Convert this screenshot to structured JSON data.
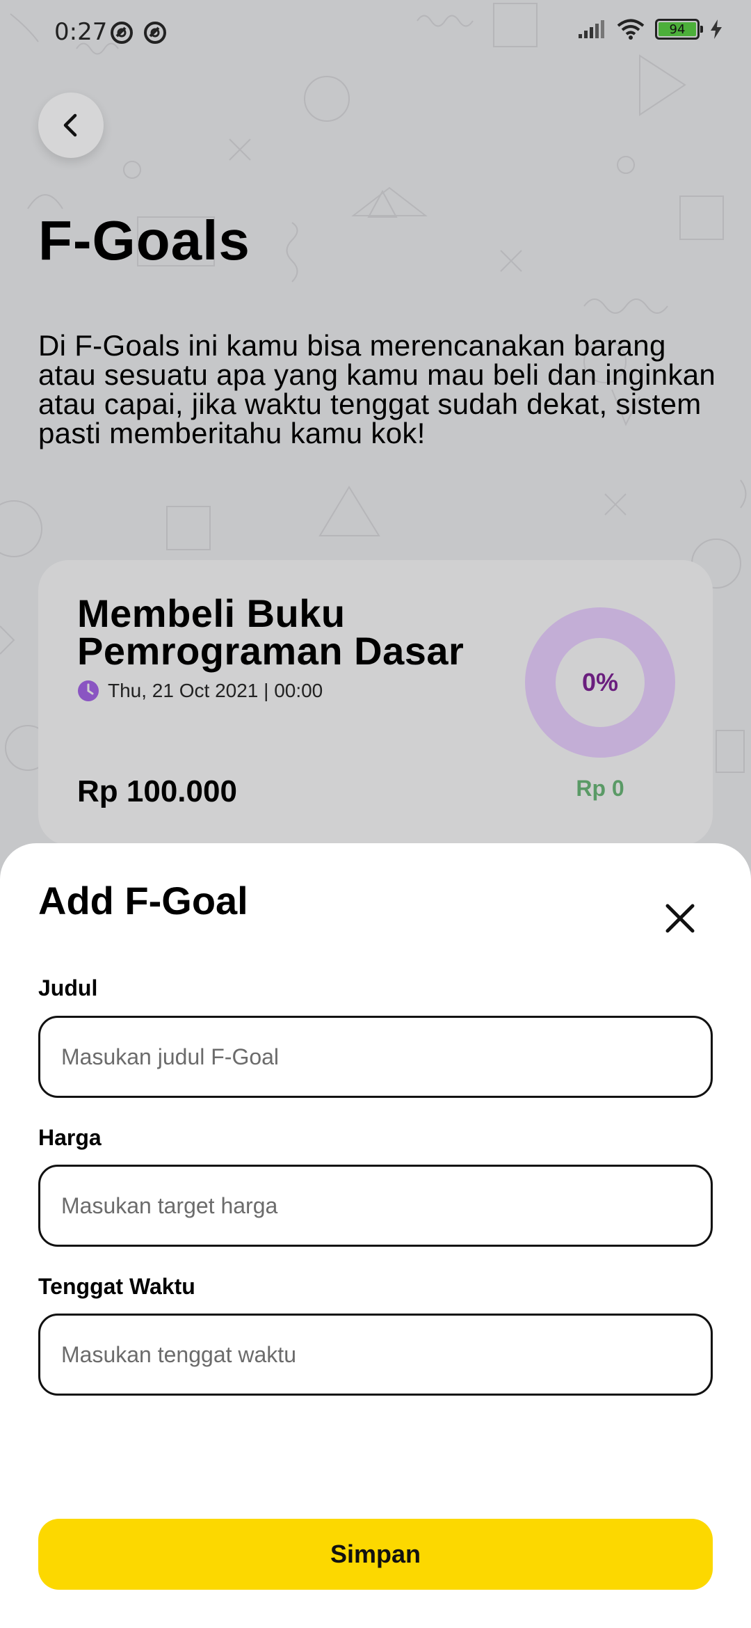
{
  "status_bar": {
    "time": "0:27",
    "battery": "94",
    "battery_color": "#4caf3a"
  },
  "header": {
    "back_icon": "chevron-left-icon",
    "title": "F-Goals",
    "description": "Di F-Goals ini kamu bisa merencanakan barang atau sesuatu apa yang kamu mau beli dan inginkan atau capai, jika waktu tenggat sudah dekat, sistem pasti memberitahu kamu kok!"
  },
  "goal_card": {
    "title": "Membeli Buku Pemrograman Dasar",
    "date": "Thu, 21 Oct 2021 | 00:00",
    "price": "Rp 100.000",
    "progress_label": "0%",
    "progress_fraction": 0,
    "saved": "Rp 0",
    "ring_color": "#c3aed6",
    "accent_color": "#6a1e7e"
  },
  "add_sheet": {
    "title": "Add F-Goal",
    "close_icon": "close-icon",
    "fields": [
      {
        "label": "Judul",
        "placeholder": "Masukan judul F-Goal",
        "value": ""
      },
      {
        "label": "Harga",
        "placeholder": "Masukan target harga",
        "value": ""
      },
      {
        "label": "Tenggat Waktu",
        "placeholder": "Masukan tenggat waktu",
        "value": ""
      }
    ],
    "save_label": "Simpan",
    "save_color": "#fcd800"
  }
}
